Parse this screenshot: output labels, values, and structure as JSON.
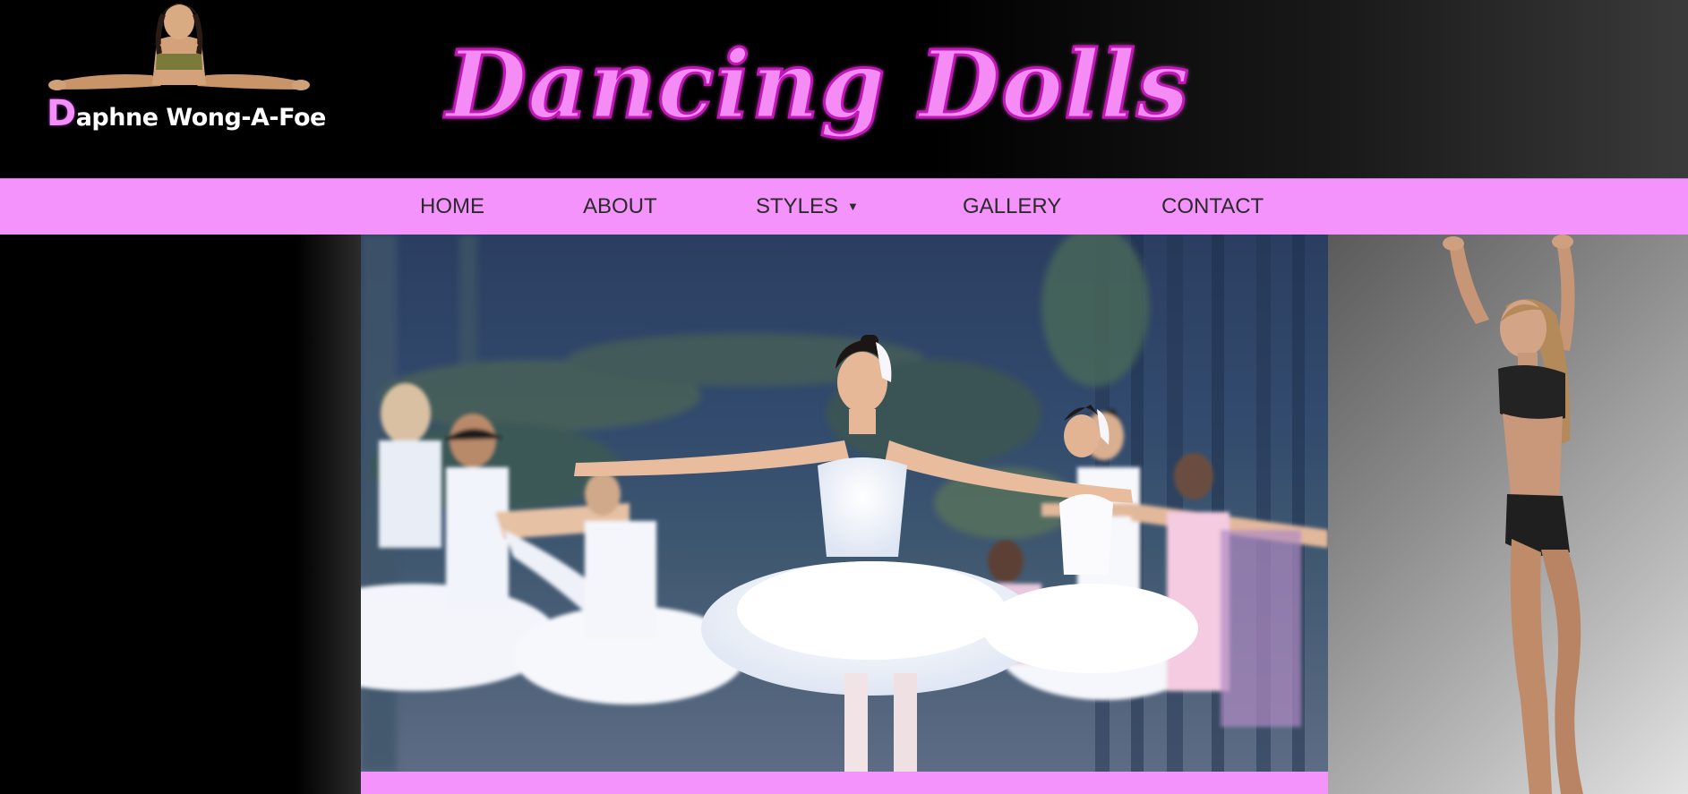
{
  "logo": {
    "initial": "D",
    "name_rest": "aphne Wong-A-Foe"
  },
  "brand": {
    "title": "Dancing Dolls"
  },
  "nav": {
    "items": [
      {
        "label": "HOME"
      },
      {
        "label": "ABOUT"
      },
      {
        "label": "STYLES",
        "caret": "▼"
      },
      {
        "label": "GALLERY"
      },
      {
        "label": "CONTACT"
      }
    ]
  },
  "colors": {
    "accent_pink": "#f393fb",
    "title_pink": "#f58cf6",
    "background": "#000000"
  },
  "images": {
    "logo_figure": "dancer-doing-splits",
    "hero": "ballet-performance-on-stage",
    "side": "dancer-posing-arms-up"
  }
}
